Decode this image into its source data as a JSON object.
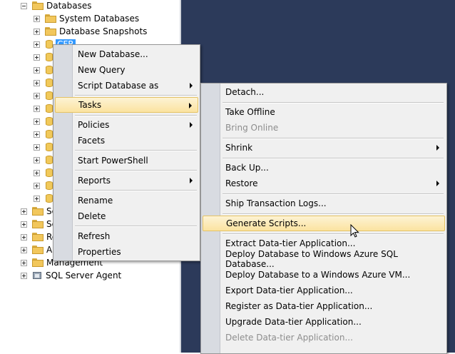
{
  "tree": {
    "items": [
      {
        "label": "Databases",
        "icon": "folder-icon"
      },
      {
        "label": "System Databases",
        "icon": "folder-icon"
      },
      {
        "label": "Database Snapshots",
        "icon": "folder-icon"
      },
      {
        "label": "CFR",
        "icon": "database-icon"
      },
      {
        "label": "Management",
        "icon": "folder-icon"
      },
      {
        "label": "SQL Server Agent",
        "icon": "agent-icon"
      }
    ],
    "partial_labels": [
      "Se",
      "Se",
      "Re",
      "A"
    ]
  },
  "context_menu": {
    "items": [
      {
        "label": "New Database..."
      },
      {
        "label": "New Query"
      },
      {
        "label": "Script Database as",
        "submenu": true
      },
      {
        "label": "Tasks",
        "submenu": true,
        "highlighted": true
      },
      {
        "label": "Policies",
        "submenu": true
      },
      {
        "label": "Facets"
      },
      {
        "label": "Start PowerShell"
      },
      {
        "label": "Reports",
        "submenu": true
      },
      {
        "label": "Rename"
      },
      {
        "label": "Delete"
      },
      {
        "label": "Refresh"
      },
      {
        "label": "Properties"
      }
    ]
  },
  "tasks_submenu": {
    "items": [
      {
        "label": "Detach..."
      },
      {
        "label": "Take Offline"
      },
      {
        "label": "Bring Online",
        "disabled": true
      },
      {
        "label": "Shrink",
        "submenu": true
      },
      {
        "label": "Back Up..."
      },
      {
        "label": "Restore",
        "submenu": true
      },
      {
        "label": "Ship Transaction Logs..."
      },
      {
        "label": "Generate Scripts...",
        "highlighted": true
      },
      {
        "label": "Extract Data-tier Application..."
      },
      {
        "label": "Deploy Database to Windows Azure SQL Database..."
      },
      {
        "label": "Deploy Database to a Windows Azure VM..."
      },
      {
        "label": "Export Data-tier Application..."
      },
      {
        "label": "Register as Data-tier Application..."
      },
      {
        "label": "Upgrade Data-tier Application..."
      },
      {
        "label": "Delete Data-tier Application...",
        "disabled": true
      }
    ]
  },
  "colors": {
    "background_dark": "#2c3a5a",
    "highlight": "#fbe3a0",
    "selection": "#3399ff"
  }
}
